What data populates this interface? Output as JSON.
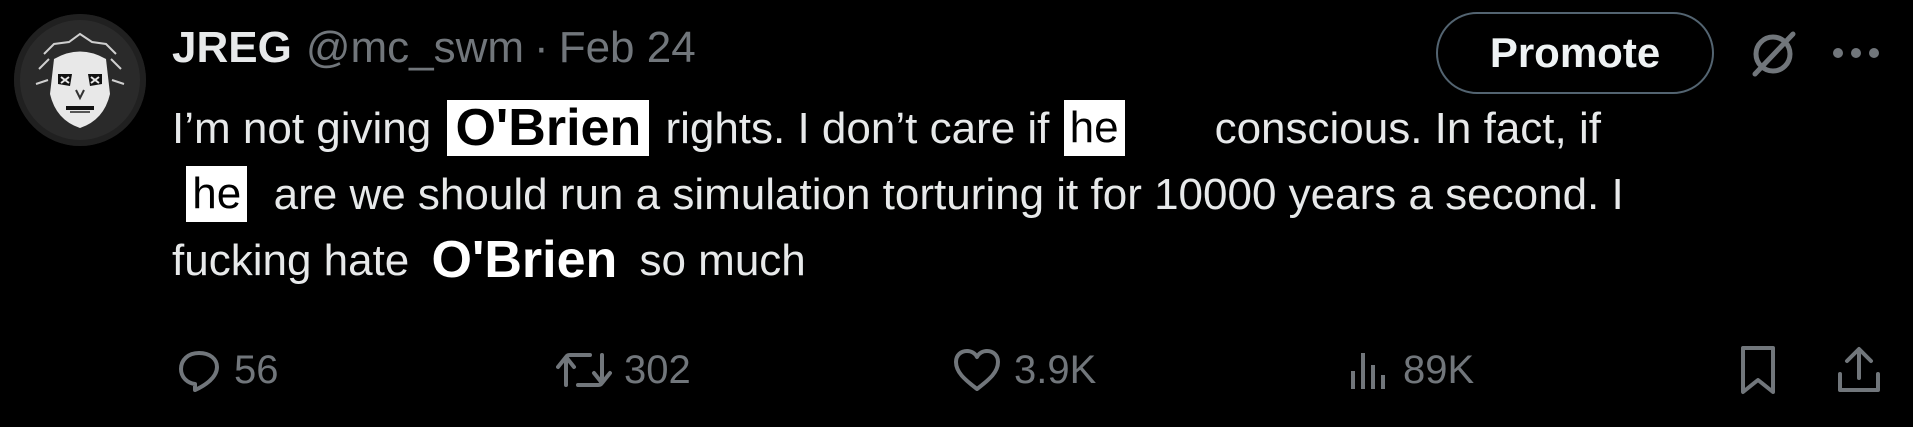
{
  "author": {
    "name": "JREG",
    "handle": "@mc_swm",
    "separator": "·",
    "date": "Feb 24",
    "avatar_icon": "avatar-mask-icon"
  },
  "header_actions": {
    "promote_label": "Promote",
    "grok_icon": "grok-slash-icon",
    "more_icon": "more-dots-icon"
  },
  "tweet": {
    "line1_a": "I’m not giving",
    "name_1": "O'Brien",
    "line1_b": "rights. I don’t care if",
    "pronoun_1": "he",
    "line1_c": "conscious. In fact, if",
    "pronoun_2": "he",
    "line2_a": "are we should run a simulation torturing it for 10000 years a second. I",
    "line3_a": "fucking hate",
    "name_2": "O'Brien",
    "line3_b": "so much"
  },
  "metrics": {
    "replies": "56",
    "reposts": "302",
    "likes": "3.9K",
    "views": "89K"
  },
  "colors": {
    "background": "#000000",
    "text": "#e7e9ea",
    "muted": "#71767b",
    "border": "#536471"
  }
}
